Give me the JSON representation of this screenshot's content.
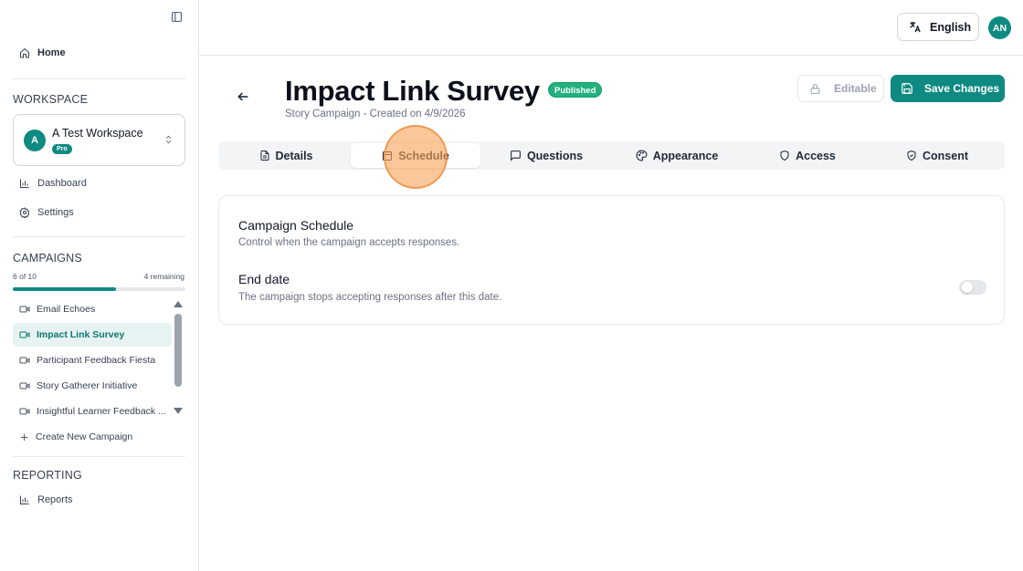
{
  "sidebar": {
    "home_label": "Home",
    "workspace_section": "WORKSPACE",
    "workspace": {
      "avatar_letter": "A",
      "name": "A Test Workspace",
      "plan_badge": "Pro"
    },
    "nav": [
      {
        "label": "Dashboard",
        "icon": "bar-chart-icon"
      },
      {
        "label": "Settings",
        "icon": "gear-icon"
      }
    ],
    "campaigns_section": "CAMPAIGNS",
    "usage": {
      "used_label": "6 of 10",
      "remaining_label": "4 remaining",
      "fraction": 0.6
    },
    "campaigns": [
      {
        "label": "Email Echoes",
        "active": false
      },
      {
        "label": "Impact Link Survey",
        "active": true
      },
      {
        "label": "Participant Feedback Fiesta",
        "active": false
      },
      {
        "label": "Story Gatherer Initiative",
        "active": false
      },
      {
        "label": "Insightful Learner Feedback ...",
        "active": false
      }
    ],
    "create_label": "Create New Campaign",
    "reporting_section": "REPORTING",
    "reports_label": "Reports"
  },
  "header": {
    "language_label": "English",
    "user_initials": "AN"
  },
  "page": {
    "title": "Impact Link Survey",
    "status_badge": "Published",
    "subtitle": "Story Campaign - Created on 4/9/2026",
    "editable_label": "Editable",
    "save_label": "Save Changes"
  },
  "tabs": [
    {
      "label": "Details",
      "icon": "file-text-icon"
    },
    {
      "label": "Schedule",
      "icon": "calendar-icon",
      "active": true
    },
    {
      "label": "Questions",
      "icon": "message-square-icon"
    },
    {
      "label": "Appearance",
      "icon": "palette-icon"
    },
    {
      "label": "Access",
      "icon": "shield-icon"
    },
    {
      "label": "Consent",
      "icon": "shield-check-icon"
    }
  ],
  "schedule": {
    "title": "Campaign Schedule",
    "description": "Control when the campaign accepts responses.",
    "end_date_label": "End date",
    "end_date_description": "The campaign stops accepting responses after this date.",
    "end_date_enabled": false
  },
  "colors": {
    "accent": "#0f8a82",
    "published": "#22b07d"
  }
}
